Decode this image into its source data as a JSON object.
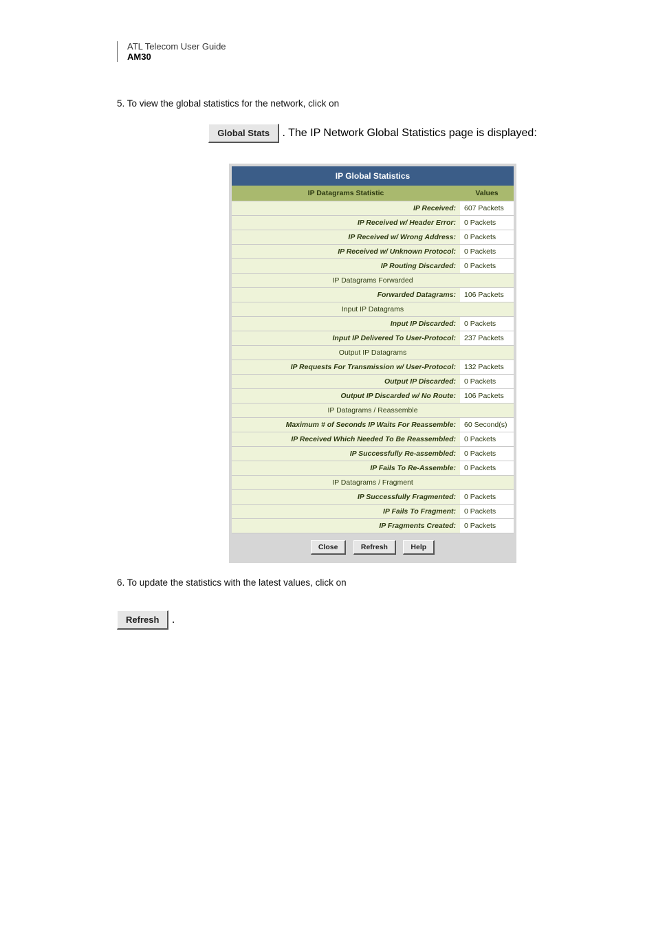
{
  "header": {
    "line1": "ATL Telecom User Guide",
    "line2": "AM30"
  },
  "intro_text": "5. To view the global statistics for the network, click on",
  "global_button": "Global Stats",
  "intro_suffix": ". The IP Network Global Statistics page is displayed:",
  "panel": {
    "title": "IP Global Statistics",
    "head_stat": "IP Datagrams Statistic",
    "head_val": "Values",
    "rows": [
      {
        "type": "row",
        "label": "IP Received:",
        "value": "607 Packets"
      },
      {
        "type": "row",
        "label": "IP Received w/ Header Error:",
        "value": "0 Packets"
      },
      {
        "type": "row",
        "label": "IP Received w/ Wrong Address:",
        "value": "0 Packets"
      },
      {
        "type": "row",
        "label": "IP Received w/ Unknown Protocol:",
        "value": "0 Packets"
      },
      {
        "type": "row",
        "label": "IP Routing Discarded:",
        "value": "0 Packets"
      },
      {
        "type": "section",
        "label": "IP Datagrams Forwarded"
      },
      {
        "type": "row",
        "label": "Forwarded Datagrams:",
        "value": "106 Packets"
      },
      {
        "type": "section",
        "label": "Input IP Datagrams"
      },
      {
        "type": "row",
        "label": "Input IP Discarded:",
        "value": "0 Packets"
      },
      {
        "type": "row",
        "label": "Input IP Delivered To User-Protocol:",
        "value": "237 Packets"
      },
      {
        "type": "section",
        "label": "Output IP Datagrams"
      },
      {
        "type": "row",
        "label": "IP Requests For Transmission w/ User-Protocol:",
        "value": "132 Packets"
      },
      {
        "type": "row",
        "label": "Output IP Discarded:",
        "value": "0 Packets"
      },
      {
        "type": "row",
        "label": "Output IP Discarded w/ No Route:",
        "value": "106 Packets"
      },
      {
        "type": "section",
        "label": "IP Datagrams / Reassemble"
      },
      {
        "type": "row",
        "label": "Maximum # of Seconds IP Waits For Reassemble:",
        "value": "60 Second(s)"
      },
      {
        "type": "row",
        "label": "IP Received Which Needed To Be Reassembled:",
        "value": "0 Packets"
      },
      {
        "type": "row",
        "label": "IP Successfully Re-assembled:",
        "value": "0 Packets"
      },
      {
        "type": "row",
        "label": "IP Fails To Re-Assemble:",
        "value": "0 Packets"
      },
      {
        "type": "section",
        "label": "IP Datagrams / Fragment"
      },
      {
        "type": "row",
        "label": "IP Successfully Fragmented:",
        "value": "0 Packets"
      },
      {
        "type": "row",
        "label": "IP Fails To Fragment:",
        "value": "0 Packets"
      },
      {
        "type": "row",
        "label": "IP Fragments Created:",
        "value": "0 Packets"
      }
    ],
    "buttons": {
      "close": "Close",
      "refresh": "Refresh",
      "help": "Help"
    }
  },
  "footer_text_1": "6. To update the statistics with the latest values, click on",
  "refresh_button": "Refresh",
  "footer_suffix": "."
}
